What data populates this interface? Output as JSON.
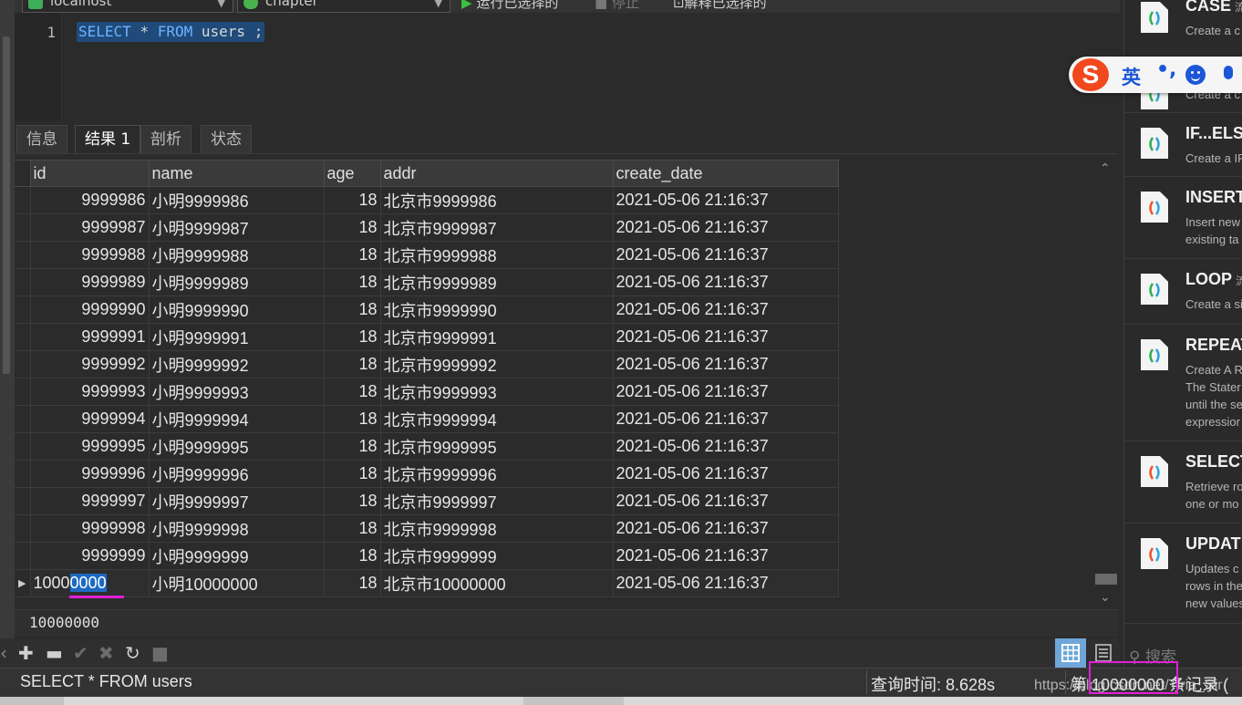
{
  "toolbar": {
    "connection": "localhost",
    "database": "chapter",
    "run_selected": "运行已选择的",
    "stop": "停止",
    "explain_selected": "解释已选择的"
  },
  "editor": {
    "line_number": "1",
    "kw_select": "SELECT",
    "star": "*",
    "kw_from": "FROM",
    "table": "users",
    "semicolon": ";"
  },
  "tabs": [
    {
      "label": "信息"
    },
    {
      "label": "结果 1"
    },
    {
      "label": "剖析"
    },
    {
      "label": "状态"
    }
  ],
  "grid": {
    "columns": [
      "id",
      "name",
      "age",
      "addr",
      "create_date"
    ],
    "rows": [
      {
        "id": "9999986",
        "name": "小明9999986",
        "age": "18",
        "addr": "北京市9999986",
        "create_date": "2021-05-06 21:16:37"
      },
      {
        "id": "9999987",
        "name": "小明9999987",
        "age": "18",
        "addr": "北京市9999987",
        "create_date": "2021-05-06 21:16:37"
      },
      {
        "id": "9999988",
        "name": "小明9999988",
        "age": "18",
        "addr": "北京市9999988",
        "create_date": "2021-05-06 21:16:37"
      },
      {
        "id": "9999989",
        "name": "小明9999989",
        "age": "18",
        "addr": "北京市9999989",
        "create_date": "2021-05-06 21:16:37"
      },
      {
        "id": "9999990",
        "name": "小明9999990",
        "age": "18",
        "addr": "北京市9999990",
        "create_date": "2021-05-06 21:16:37"
      },
      {
        "id": "9999991",
        "name": "小明9999991",
        "age": "18",
        "addr": "北京市9999991",
        "create_date": "2021-05-06 21:16:37"
      },
      {
        "id": "9999992",
        "name": "小明9999992",
        "age": "18",
        "addr": "北京市9999992",
        "create_date": "2021-05-06 21:16:37"
      },
      {
        "id": "9999993",
        "name": "小明9999993",
        "age": "18",
        "addr": "北京市9999993",
        "create_date": "2021-05-06 21:16:37"
      },
      {
        "id": "9999994",
        "name": "小明9999994",
        "age": "18",
        "addr": "北京市9999994",
        "create_date": "2021-05-06 21:16:37"
      },
      {
        "id": "9999995",
        "name": "小明9999995",
        "age": "18",
        "addr": "北京市9999995",
        "create_date": "2021-05-06 21:16:37"
      },
      {
        "id": "9999996",
        "name": "小明9999996",
        "age": "18",
        "addr": "北京市9999996",
        "create_date": "2021-05-06 21:16:37"
      },
      {
        "id": "9999997",
        "name": "小明9999997",
        "age": "18",
        "addr": "北京市9999997",
        "create_date": "2021-05-06 21:16:37"
      },
      {
        "id": "9999998",
        "name": "小明9999998",
        "age": "18",
        "addr": "北京市9999998",
        "create_date": "2021-05-06 21:16:37"
      },
      {
        "id": "9999999",
        "name": "小明9999999",
        "age": "18",
        "addr": "北京市9999999",
        "create_date": "2021-05-06 21:16:37"
      }
    ],
    "current_row": {
      "id_prefix": "1000",
      "id_selected": "0000",
      "name": "小明10000000",
      "age": "18",
      "addr": "北京市10000000",
      "create_date": "2021-05-06 21:16:37"
    }
  },
  "value_bar": "10000000",
  "status": {
    "sql": "SELECT * FROM users",
    "query_time": "查询时间: 8.628s",
    "records": "第 10000000 条记录 (",
    "watermark": "https://blog.csdn.net/Tiria_Sir"
  },
  "snippets": [
    {
      "title": "CASE",
      "tag": "流",
      "desc": "Create a c"
    },
    {
      "title": "",
      "tag": "",
      "desc": "Create a c"
    },
    {
      "title": "IF...ELS",
      "tag": "",
      "desc": "Create a IF"
    },
    {
      "title": "INSERT",
      "tag": "",
      "desc": "Insert new\nexisting ta"
    },
    {
      "title": "LOOP",
      "tag": "流",
      "desc": "Create a si"
    },
    {
      "title": "REPEAT",
      "tag": "",
      "desc": "Create A R\nThe Stater\nuntil the se\nexpressior"
    },
    {
      "title": "SELECT",
      "tag": "",
      "desc": "Retrieve ro\none or mo"
    },
    {
      "title": "UPDAT",
      "tag": "",
      "desc": "Updates c\nrows in the\nnew values"
    }
  ],
  "snippet_search_placeholder": "搜索",
  "ime": {
    "logo": "S",
    "lang": "英",
    "punct": "•,"
  },
  "colors": {
    "selection": "#1d6ac2",
    "annotation": "#e21fd6",
    "ime_brand": "#f1481e"
  }
}
